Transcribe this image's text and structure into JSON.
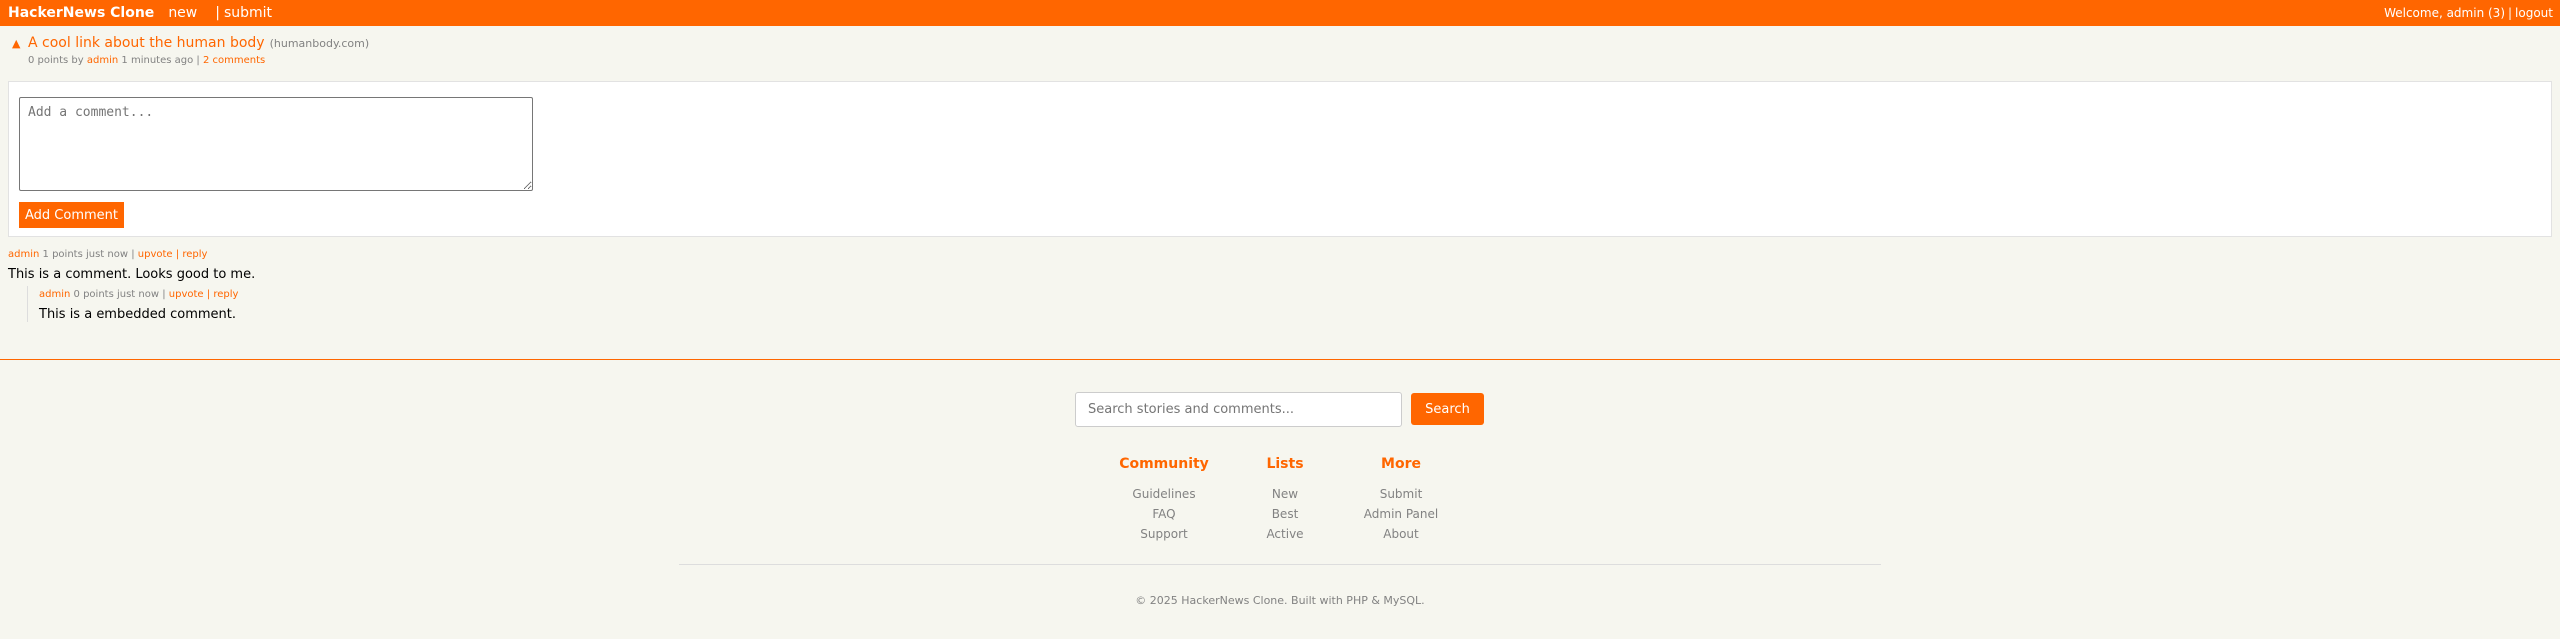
{
  "header": {
    "brand": "HackerNews Clone",
    "nav": {
      "new": "new",
      "separator": "|",
      "submit": "submit"
    },
    "user": {
      "welcome": "Welcome, admin (3)",
      "separator": "|",
      "logout": "logout"
    }
  },
  "story": {
    "upvote_icon": "▲",
    "title": "A cool link about the human body",
    "domain": "(humanbody.com)",
    "points_text": "0 points by",
    "author": "admin",
    "time_text": "1 minutes ago |",
    "comments_link": "2 comments"
  },
  "comment_form": {
    "placeholder": "Add a comment...",
    "button_label": "Add Comment"
  },
  "comments": [
    {
      "author": "admin",
      "meta": "1 points just now |",
      "upvote": "upvote",
      "sep": "|",
      "reply": "reply",
      "text": "This is a comment. Looks good to me."
    },
    {
      "author": "admin",
      "meta": "0 points just now |",
      "upvote": "upvote",
      "sep": "|",
      "reply": "reply",
      "text": "This is a embedded comment."
    }
  ],
  "footer": {
    "search_placeholder": "Search stories and comments...",
    "search_button": "Search",
    "columns": [
      {
        "title": "Community",
        "links": [
          "Guidelines",
          "FAQ",
          "Support"
        ]
      },
      {
        "title": "Lists",
        "links": [
          "New",
          "Best",
          "Active"
        ]
      },
      {
        "title": "More",
        "links": [
          "Submit",
          "Admin Panel",
          "About"
        ]
      }
    ],
    "copyright": "© 2025 HackerNews Clone. Built with PHP & MySQL."
  },
  "colors": {
    "accent": "#ff6600",
    "background": "#f6f6ef",
    "muted": "#828282"
  }
}
